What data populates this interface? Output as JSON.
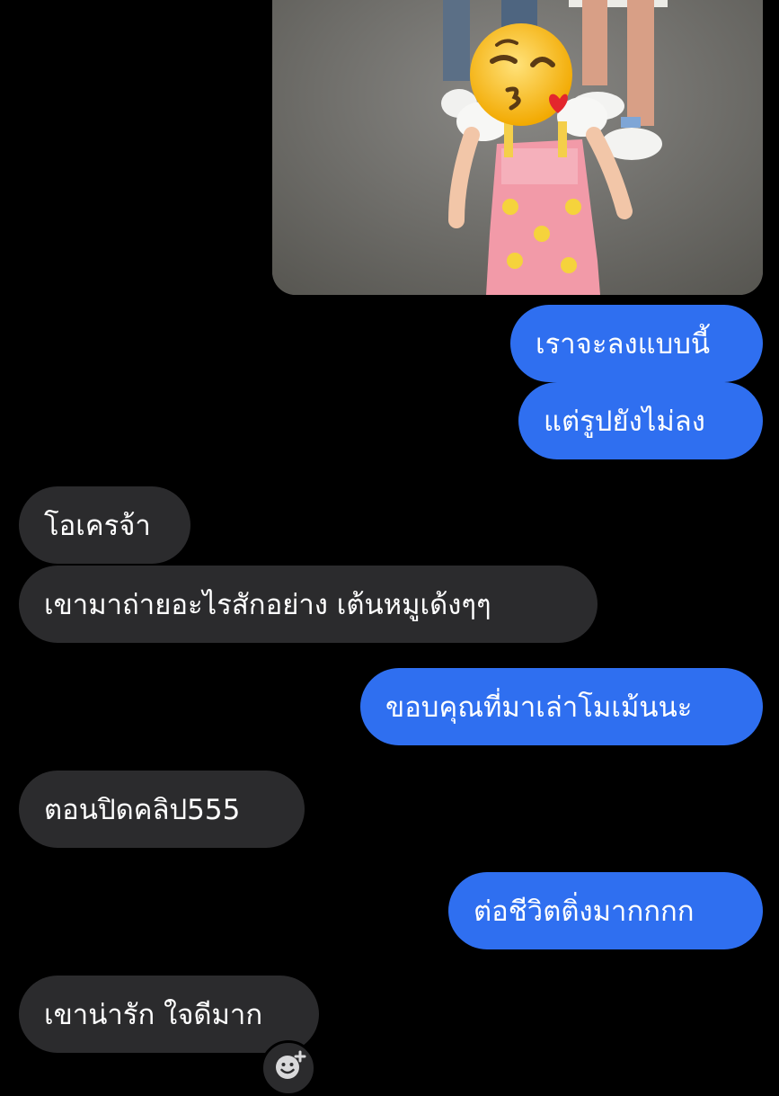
{
  "messages": [
    {
      "from": "me",
      "text": "เราจะลงแบบนี้"
    },
    {
      "from": "me",
      "text": "แต่รูปยังไม่ลง"
    },
    {
      "from": "them",
      "text": "โอเครจ้า"
    },
    {
      "from": "them",
      "text": "เขามาถ่ายอะไรสักอย่าง เต้นหมูเด้งๆๆ"
    },
    {
      "from": "me",
      "text": "ขอบคุณที่มาเล่าโมเม้นนะ"
    },
    {
      "from": "them",
      "text": "ตอนปิดคลิป555"
    },
    {
      "from": "me",
      "text": "ต่อชีวิตติ่งมากกกก"
    },
    {
      "from": "them",
      "text": "เขาน่ารัก ใจดีมาก"
    }
  ],
  "colors": {
    "background": "#000000",
    "outgoing_bubble": "#2f6ff0",
    "incoming_bubble": "#2b2b2d",
    "text": "#ffffff"
  },
  "icons": {
    "photo_overlay": "kissing-face-emoji",
    "reaction": "add-reaction-smiley-icon"
  }
}
